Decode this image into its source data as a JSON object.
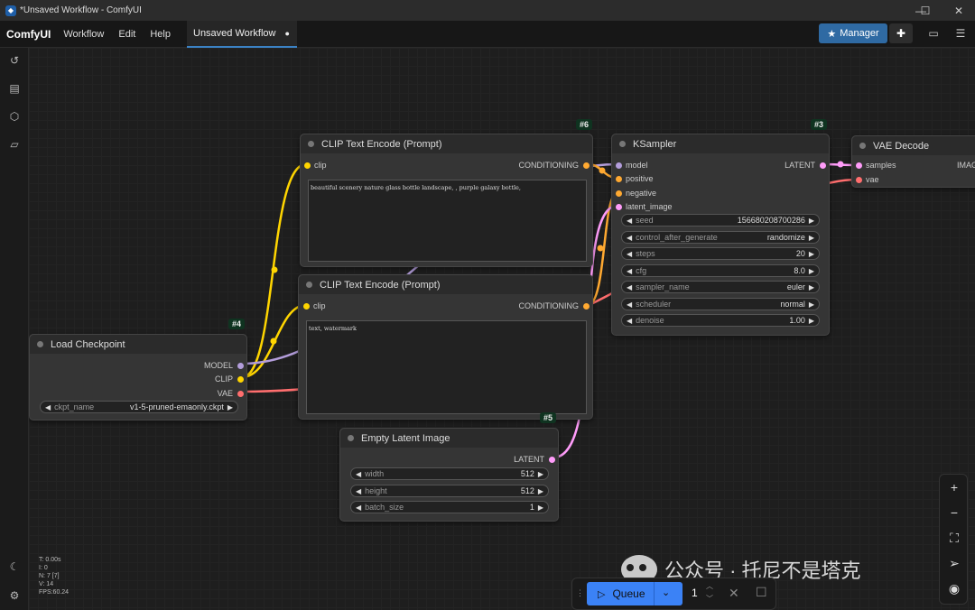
{
  "window": {
    "title": "*Unsaved Workflow - ComfyUI",
    "min_icon": "minimize-icon",
    "max_icon": "maximize-icon",
    "close_icon": "close-icon"
  },
  "menubar": {
    "brand": "ComfyUI",
    "items": [
      "Workflow",
      "Edit",
      "Help"
    ],
    "tab_label": "Unsaved Workflow",
    "tab_modified_marker": "●",
    "manager_label": "Manager"
  },
  "sidebar": {
    "icons": [
      "history-icon",
      "queue-list-icon",
      "model-library-icon",
      "workflows-folder-icon",
      "theme-toggle-icon",
      "settings-icon"
    ]
  },
  "nodes": {
    "clip_positive": {
      "id": "#6",
      "title": "CLIP Text Encode (Prompt)",
      "input": "clip",
      "output": "CONDITIONING",
      "text": "beautiful scenery nature glass bottle landscape, , purple galaxy bottle,"
    },
    "clip_negative": {
      "title": "CLIP Text Encode (Prompt)",
      "input": "clip",
      "output": "CONDITIONING",
      "text": "text, watermark"
    },
    "ksampler": {
      "id": "#3",
      "title": "KSampler",
      "inputs": [
        "model",
        "positive",
        "negative",
        "latent_image"
      ],
      "output": "LATENT",
      "widgets": [
        {
          "label": "seed",
          "value": "156680208700286"
        },
        {
          "label": "control_after_generate",
          "value": "randomize"
        },
        {
          "label": "steps",
          "value": "20"
        },
        {
          "label": "cfg",
          "value": "8.0"
        },
        {
          "label": "sampler_name",
          "value": "euler"
        },
        {
          "label": "scheduler",
          "value": "normal"
        },
        {
          "label": "denoise",
          "value": "1.00"
        }
      ]
    },
    "vae_decode": {
      "title": "VAE Decode",
      "inputs": [
        "samples",
        "vae"
      ],
      "output_partial": "IMAG"
    },
    "load_checkpoint": {
      "id": "#4",
      "title": "Load Checkpoint",
      "outputs": [
        "MODEL",
        "CLIP",
        "VAE"
      ],
      "widget": {
        "label": "ckpt_name",
        "value": "v1-5-pruned-emaonly.ckpt"
      }
    },
    "empty_latent": {
      "id": "#5",
      "title": "Empty Latent Image",
      "output": "LATENT",
      "widgets": [
        {
          "label": "width",
          "value": "512"
        },
        {
          "label": "height",
          "value": "512"
        },
        {
          "label": "batch_size",
          "value": "1"
        }
      ]
    }
  },
  "stats": [
    "T: 0.00s",
    "I: 0",
    "N: 7 [7]",
    "V: 14",
    "FPS:60.24"
  ],
  "queue": {
    "label": "Queue",
    "count": "1"
  },
  "watermark": "公众号 · 托尼不是塔克",
  "colors": {
    "accent": "#3b82f6",
    "manager": "#2f6aa3",
    "clip_link": "#ffd500",
    "model_link": "#b39ddb",
    "vae_link": "#ff6e6e",
    "conditioning_link": "#ffa931",
    "latent_link": "#ff9cf9"
  }
}
